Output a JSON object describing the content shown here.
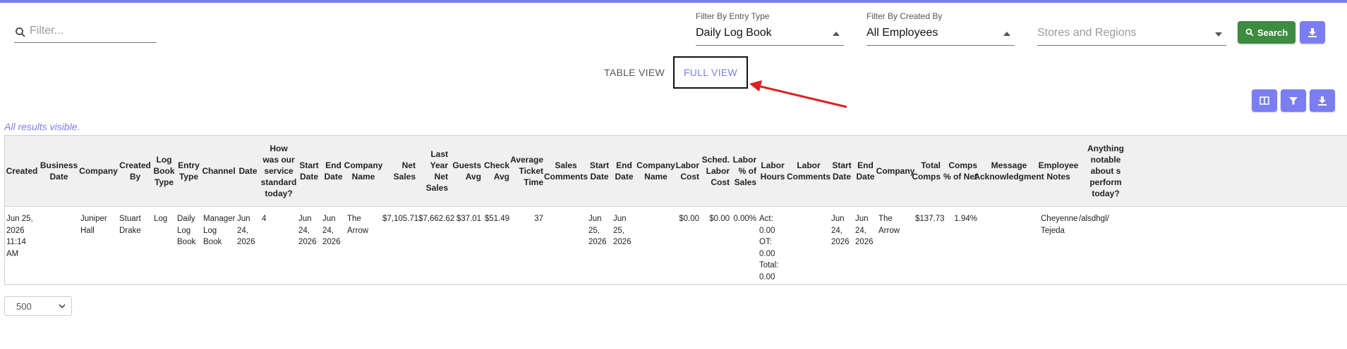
{
  "filter": {
    "placeholder": "Filter..."
  },
  "filters": {
    "entry_type": {
      "label": "Filter By Entry Type",
      "value": "Daily Log Book"
    },
    "created_by": {
      "label": "Filter By Created By",
      "value": "All Employees"
    },
    "stores": {
      "placeholder": "Stores and Regions"
    }
  },
  "toolbar": {
    "search_label": "Search"
  },
  "tabs": {
    "table": "TABLE VIEW",
    "full": "FULL VIEW"
  },
  "status": "All results visible.",
  "table": {
    "headers": [
      "Created",
      "Business Date",
      "Company",
      "Created By",
      "Log Book Type",
      "Entry Type",
      "Channel",
      "Date",
      "How was our service standard today?",
      "Start Date",
      "End Date",
      "Company Name",
      "Net Sales",
      "Last Year Net Sales",
      "Guests Avg",
      "Check Avg",
      "Average Ticket Time",
      "Sales Comments",
      "Start Date",
      "End Date",
      "Company Name",
      "Labor Cost",
      "Sched. Labor Cost",
      "Labor % of Sales",
      "Labor Hours",
      "Labor Comments",
      "Start Date",
      "End Date",
      "Company",
      "Total Comps",
      "Comps % of Net",
      "Message Acknowledgment",
      "Employee Notes",
      "Anything notable about s perform today?"
    ],
    "rows": [
      [
        "Jun 25, 2026 11:14 AM",
        "",
        "Juniper Hall",
        "Stuart Drake",
        "Log",
        "Daily Log Book",
        "Manager Log Book",
        "Jun 24, 2026",
        "4",
        "Jun 24, 2026",
        "Jun 24, 2026",
        "The Arrow",
        "$7,105.71",
        "$7,662.62",
        "$37.01",
        "$51.49",
        "37",
        "",
        "Jun 25, 2026",
        "Jun 25, 2026",
        "",
        "$0.00",
        "$0.00",
        "0.00%",
        "Act: 0.00 OT: 0.00 Total: 0.00",
        "",
        "Jun 24, 2026",
        "Jun 24, 2026",
        "The Arrow",
        "$137.73",
        "1.94%",
        "",
        "Cheyenne Tejeda",
        "/alsdhgl/"
      ]
    ]
  },
  "pagination": {
    "page_size": "500"
  },
  "colors": {
    "accent": "#7b7ef0",
    "search_green": "#3d8c40",
    "annotation_red": "#e02020"
  }
}
